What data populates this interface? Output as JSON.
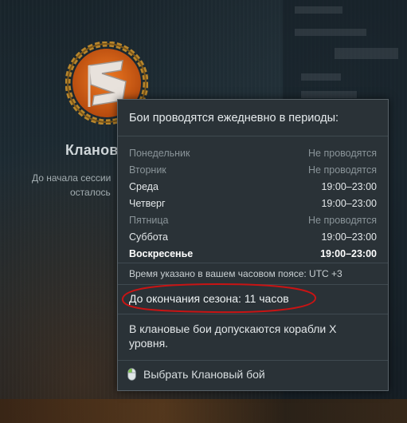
{
  "clan_panel": {
    "title": "Клановы",
    "session_line1": "До начала сессии",
    "session_line2": "осталось"
  },
  "tooltip": {
    "title": "Бои проводятся ежедневно в периоды:",
    "schedule": [
      {
        "day": "Понедельник",
        "time": "Не проводятся",
        "state": "off"
      },
      {
        "day": "Вторник",
        "time": "Не проводятся",
        "state": "off"
      },
      {
        "day": "Среда",
        "time": "19:00–23:00",
        "state": "on"
      },
      {
        "day": "Четверг",
        "time": "19:00–23:00",
        "state": "on"
      },
      {
        "day": "Пятница",
        "time": "Не проводятся",
        "state": "off"
      },
      {
        "day": "Суббота",
        "time": "19:00–23:00",
        "state": "on"
      },
      {
        "day": "Воскресенье",
        "time": "19:00–23:00",
        "state": "today"
      }
    ],
    "timezone_note": "Время указано в вашем часовом поясе: UTC +3",
    "season_end": "До окончания сезона: 11 часов",
    "tier_note": "В клановые бои допускаются корабли X уровня.",
    "select_action": "Выбрать Клановый бой",
    "select_icon": "mouse-icon"
  },
  "colors": {
    "tooltip_bg": "#2a3237",
    "highlight_ellipse": "#c81414",
    "emblem_orange": "#e06a1a"
  }
}
